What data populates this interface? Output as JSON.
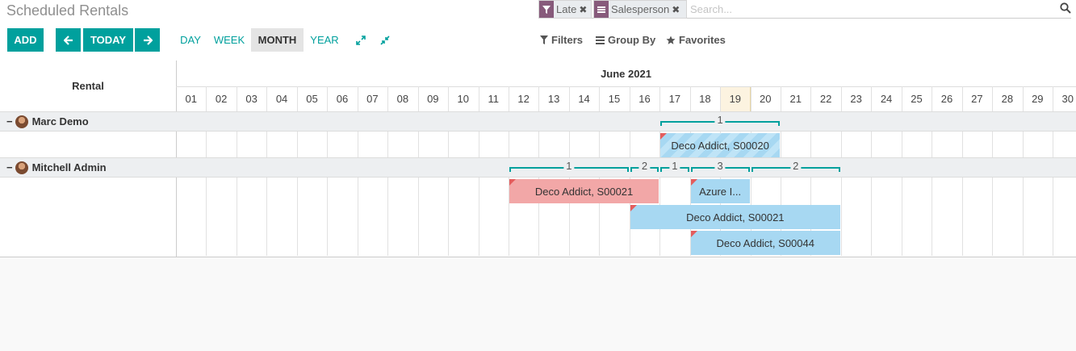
{
  "title": "Scheduled Rentals",
  "search": {
    "facets": [
      {
        "icon": "filter-icon",
        "label": "Late"
      },
      {
        "icon": "group-by-icon",
        "label": "Salesperson"
      }
    ],
    "placeholder": "Search..."
  },
  "toolbar": {
    "add_label": "ADD",
    "today_label": "TODAY",
    "scales": [
      "DAY",
      "WEEK",
      "MONTH",
      "YEAR"
    ],
    "active_scale": "MONTH",
    "filters_label": "Filters",
    "groupby_label": "Group By",
    "favorites_label": "Favorites"
  },
  "gantt": {
    "row_header": "Rental",
    "month": "June 2021",
    "days": [
      "01",
      "02",
      "03",
      "04",
      "05",
      "06",
      "07",
      "08",
      "09",
      "10",
      "11",
      "12",
      "13",
      "14",
      "15",
      "16",
      "17",
      "18",
      "19",
      "20",
      "21",
      "22",
      "23",
      "24",
      "25",
      "26",
      "27",
      "28",
      "29",
      "30"
    ],
    "today": "19",
    "groups": [
      {
        "name": "Marc Demo",
        "counts": [
          {
            "label": "1",
            "from": "17",
            "to": "20"
          }
        ],
        "pills": [
          {
            "label": "Deco Addict, S00020",
            "from": "17",
            "to": "20",
            "color": "blue",
            "hatched": true
          }
        ]
      },
      {
        "name": "Mitchell Admin",
        "counts": [
          {
            "label": "1",
            "from": "12",
            "to": "15"
          },
          {
            "label": "2",
            "from": "16",
            "to": "16"
          },
          {
            "label": "1",
            "from": "17",
            "to": "17"
          },
          {
            "label": "3",
            "from": "18",
            "to": "19"
          },
          {
            "label": "2",
            "from": "20",
            "to": "22"
          }
        ],
        "pills": [
          {
            "label": "Deco Addict, S00021",
            "from": "12",
            "to": "16",
            "color": "red"
          },
          {
            "label": "Azure I...",
            "from": "18",
            "to": "19",
            "color": "blue"
          },
          {
            "label": "Deco Addict, S00021",
            "from": "16",
            "to": "22",
            "color": "blue"
          },
          {
            "label": "Deco Addict, S00044",
            "from": "18",
            "to": "22",
            "color": "blue"
          }
        ]
      }
    ]
  }
}
